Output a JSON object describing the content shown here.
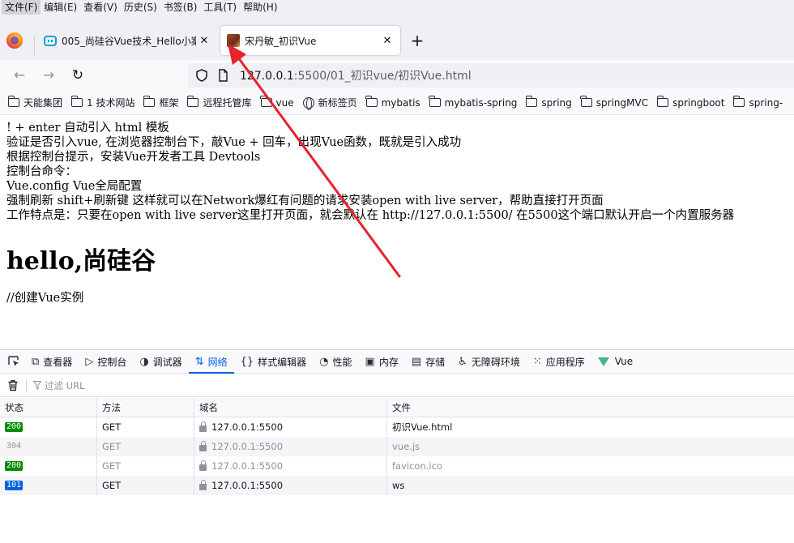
{
  "menu": [
    "文件(F)",
    "编辑(E)",
    "查看(V)",
    "历史(S)",
    "书签(B)",
    "工具(T)",
    "帮助(H)"
  ],
  "tabs": [
    {
      "title": "005_尚硅谷Vue技术_Hello小案",
      "close": "✕"
    },
    {
      "title": "宋丹敏_初识Vue",
      "close": "✕"
    }
  ],
  "newtab": "+",
  "nav": {
    "back": "←",
    "forward": "→",
    "reload": "↻"
  },
  "url": {
    "host": "127.0.0.1",
    "rest": ":5500/01_初识vue/初识Vue.html"
  },
  "bookmarks": [
    {
      "label": "天能集团",
      "icon": "folder-icon"
    },
    {
      "label": "1 技术网站",
      "icon": "folder-icon"
    },
    {
      "label": "框架",
      "icon": "folder-icon"
    },
    {
      "label": "远程托管库",
      "icon": "folder-icon"
    },
    {
      "label": "vue",
      "icon": "folder-icon"
    },
    {
      "label": "新标签页",
      "icon": "globe-icon"
    },
    {
      "label": "mybatis",
      "icon": "folder-icon"
    },
    {
      "label": "mybatis-spring",
      "icon": "folder-icon"
    },
    {
      "label": "spring",
      "icon": "folder-icon"
    },
    {
      "label": "springMVC",
      "icon": "folder-icon"
    },
    {
      "label": "springboot",
      "icon": "folder-icon"
    },
    {
      "label": "spring-",
      "icon": "folder-icon"
    }
  ],
  "page": {
    "lines": [
      "! + enter 自动引入 html 模板",
      "验证是否引入vue, 在浏览器控制台下，敲Vue + 回车，出现Vue函数，既就是引入成功",
      "根据控制台提示，安装Vue开发者工具 Devtools",
      "控制台命令：",
      "Vue.config Vue全局配置",
      "强制刷新 shift+刷新键 这样就可以在Network爆红有问题的请求安装open with live server，帮助直接打开页面",
      "工作特点是：只要在open with live server这里打开页面，就会默认在 http://127.0.0.1:5500/ 在5500这个端口默认开启一个内置服务器"
    ],
    "heading": "hello,尚硅谷",
    "comment": "//创建Vue实例"
  },
  "devtools": {
    "tabs": [
      {
        "label": "查看器",
        "icon": "⧉"
      },
      {
        "label": "控制台",
        "icon": "▷"
      },
      {
        "label": "调试器",
        "icon": "◑"
      },
      {
        "label": "网络",
        "icon": "⇅"
      },
      {
        "label": "样式编辑器",
        "icon": "{}"
      },
      {
        "label": "性能",
        "icon": "◔"
      },
      {
        "label": "内存",
        "icon": "▣"
      },
      {
        "label": "存储",
        "icon": "▤"
      },
      {
        "label": "无障碍环境",
        "icon": "♿"
      },
      {
        "label": "应用程序",
        "icon": "⁙"
      },
      {
        "label": "Vue",
        "icon": "vue-icon"
      }
    ],
    "active_tab": "网络",
    "filter_placeholder": "过滤 URL",
    "columns": [
      "状态",
      "方法",
      "域名",
      "文件"
    ],
    "requests": [
      {
        "status": "200",
        "method": "GET",
        "domain": "127.0.0.1:5500",
        "file": "初识Vue.html"
      },
      {
        "status": "304",
        "method": "GET",
        "domain": "127.0.0.1:5500",
        "file": "vue.js"
      },
      {
        "status": "200",
        "method": "GET",
        "domain": "127.0.0.1:5500",
        "file": "favicon.ico"
      },
      {
        "status": "101",
        "method": "GET",
        "domain": "127.0.0.1:5500",
        "file": "ws"
      }
    ]
  },
  "colors": {
    "accent": "#0061e0",
    "ok": "#058b00",
    "vue": "#41b883",
    "arrow": "#e8222a"
  }
}
